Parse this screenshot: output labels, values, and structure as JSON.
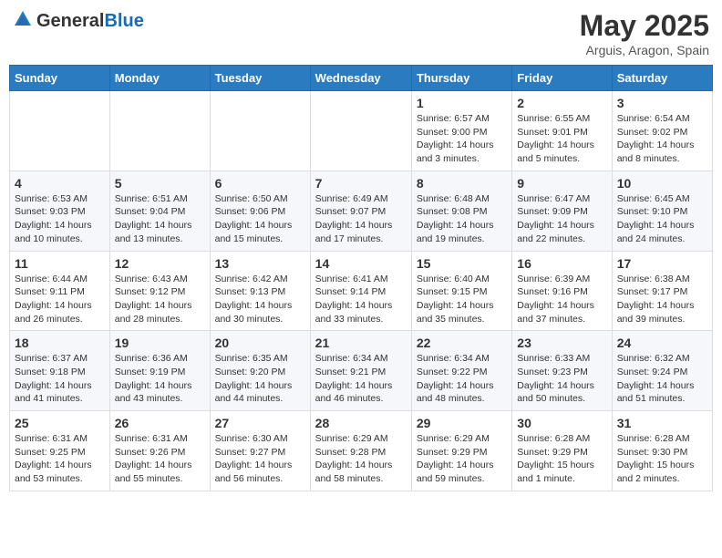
{
  "header": {
    "logo_general": "General",
    "logo_blue": "Blue",
    "month_title": "May 2025",
    "subtitle": "Arguis, Aragon, Spain"
  },
  "days_of_week": [
    "Sunday",
    "Monday",
    "Tuesday",
    "Wednesday",
    "Thursday",
    "Friday",
    "Saturday"
  ],
  "weeks": [
    [
      {
        "day": "",
        "info": ""
      },
      {
        "day": "",
        "info": ""
      },
      {
        "day": "",
        "info": ""
      },
      {
        "day": "",
        "info": ""
      },
      {
        "day": "1",
        "info": "Sunrise: 6:57 AM\nSunset: 9:00 PM\nDaylight: 14 hours\nand 3 minutes."
      },
      {
        "day": "2",
        "info": "Sunrise: 6:55 AM\nSunset: 9:01 PM\nDaylight: 14 hours\nand 5 minutes."
      },
      {
        "day": "3",
        "info": "Sunrise: 6:54 AM\nSunset: 9:02 PM\nDaylight: 14 hours\nand 8 minutes."
      }
    ],
    [
      {
        "day": "4",
        "info": "Sunrise: 6:53 AM\nSunset: 9:03 PM\nDaylight: 14 hours\nand 10 minutes."
      },
      {
        "day": "5",
        "info": "Sunrise: 6:51 AM\nSunset: 9:04 PM\nDaylight: 14 hours\nand 13 minutes."
      },
      {
        "day": "6",
        "info": "Sunrise: 6:50 AM\nSunset: 9:06 PM\nDaylight: 14 hours\nand 15 minutes."
      },
      {
        "day": "7",
        "info": "Sunrise: 6:49 AM\nSunset: 9:07 PM\nDaylight: 14 hours\nand 17 minutes."
      },
      {
        "day": "8",
        "info": "Sunrise: 6:48 AM\nSunset: 9:08 PM\nDaylight: 14 hours\nand 19 minutes."
      },
      {
        "day": "9",
        "info": "Sunrise: 6:47 AM\nSunset: 9:09 PM\nDaylight: 14 hours\nand 22 minutes."
      },
      {
        "day": "10",
        "info": "Sunrise: 6:45 AM\nSunset: 9:10 PM\nDaylight: 14 hours\nand 24 minutes."
      }
    ],
    [
      {
        "day": "11",
        "info": "Sunrise: 6:44 AM\nSunset: 9:11 PM\nDaylight: 14 hours\nand 26 minutes."
      },
      {
        "day": "12",
        "info": "Sunrise: 6:43 AM\nSunset: 9:12 PM\nDaylight: 14 hours\nand 28 minutes."
      },
      {
        "day": "13",
        "info": "Sunrise: 6:42 AM\nSunset: 9:13 PM\nDaylight: 14 hours\nand 30 minutes."
      },
      {
        "day": "14",
        "info": "Sunrise: 6:41 AM\nSunset: 9:14 PM\nDaylight: 14 hours\nand 33 minutes."
      },
      {
        "day": "15",
        "info": "Sunrise: 6:40 AM\nSunset: 9:15 PM\nDaylight: 14 hours\nand 35 minutes."
      },
      {
        "day": "16",
        "info": "Sunrise: 6:39 AM\nSunset: 9:16 PM\nDaylight: 14 hours\nand 37 minutes."
      },
      {
        "day": "17",
        "info": "Sunrise: 6:38 AM\nSunset: 9:17 PM\nDaylight: 14 hours\nand 39 minutes."
      }
    ],
    [
      {
        "day": "18",
        "info": "Sunrise: 6:37 AM\nSunset: 9:18 PM\nDaylight: 14 hours\nand 41 minutes."
      },
      {
        "day": "19",
        "info": "Sunrise: 6:36 AM\nSunset: 9:19 PM\nDaylight: 14 hours\nand 43 minutes."
      },
      {
        "day": "20",
        "info": "Sunrise: 6:35 AM\nSunset: 9:20 PM\nDaylight: 14 hours\nand 44 minutes."
      },
      {
        "day": "21",
        "info": "Sunrise: 6:34 AM\nSunset: 9:21 PM\nDaylight: 14 hours\nand 46 minutes."
      },
      {
        "day": "22",
        "info": "Sunrise: 6:34 AM\nSunset: 9:22 PM\nDaylight: 14 hours\nand 48 minutes."
      },
      {
        "day": "23",
        "info": "Sunrise: 6:33 AM\nSunset: 9:23 PM\nDaylight: 14 hours\nand 50 minutes."
      },
      {
        "day": "24",
        "info": "Sunrise: 6:32 AM\nSunset: 9:24 PM\nDaylight: 14 hours\nand 51 minutes."
      }
    ],
    [
      {
        "day": "25",
        "info": "Sunrise: 6:31 AM\nSunset: 9:25 PM\nDaylight: 14 hours\nand 53 minutes."
      },
      {
        "day": "26",
        "info": "Sunrise: 6:31 AM\nSunset: 9:26 PM\nDaylight: 14 hours\nand 55 minutes."
      },
      {
        "day": "27",
        "info": "Sunrise: 6:30 AM\nSunset: 9:27 PM\nDaylight: 14 hours\nand 56 minutes."
      },
      {
        "day": "28",
        "info": "Sunrise: 6:29 AM\nSunset: 9:28 PM\nDaylight: 14 hours\nand 58 minutes."
      },
      {
        "day": "29",
        "info": "Sunrise: 6:29 AM\nSunset: 9:29 PM\nDaylight: 14 hours\nand 59 minutes."
      },
      {
        "day": "30",
        "info": "Sunrise: 6:28 AM\nSunset: 9:29 PM\nDaylight: 15 hours\nand 1 minute."
      },
      {
        "day": "31",
        "info": "Sunrise: 6:28 AM\nSunset: 9:30 PM\nDaylight: 15 hours\nand 2 minutes."
      }
    ]
  ]
}
